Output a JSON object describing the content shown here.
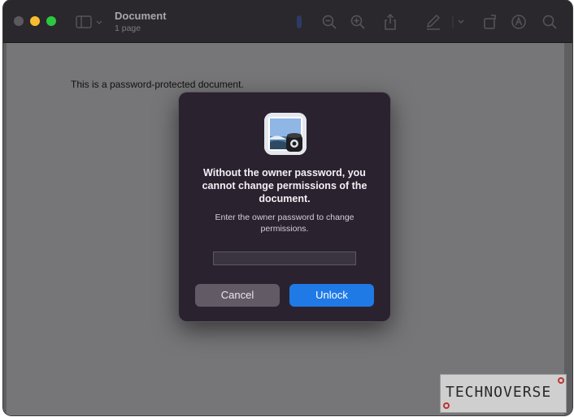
{
  "window": {
    "title": "Document",
    "subtitle": "1 page"
  },
  "toolbar": {
    "icons": [
      "sidebar-icon",
      "chevron-down-icon",
      "info-icon",
      "zoom-out-icon",
      "zoom-in-icon",
      "share-icon",
      "markup-icon",
      "chevron-down-icon",
      "rotate-icon",
      "annotate-icon",
      "search-icon"
    ]
  },
  "document": {
    "body_text": "This is a password-protected document."
  },
  "dialog": {
    "title": "Without the owner password, you cannot change permissions of the document.",
    "message": "Enter the owner password to change permissions.",
    "password_value": "",
    "cancel_label": "Cancel",
    "unlock_label": "Unlock"
  },
  "watermark": {
    "text": "TECHNOVERSE"
  },
  "colors": {
    "accent": "#1f7ae6",
    "dialog_bg": "#2b2230",
    "minimize": "#f7bd2f",
    "maximize": "#2bc840"
  }
}
